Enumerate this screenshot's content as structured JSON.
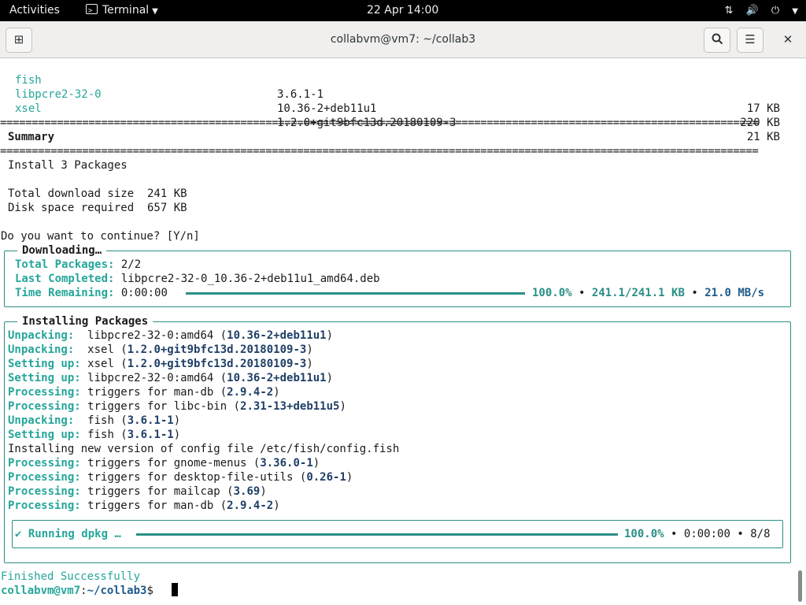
{
  "topbar": {
    "activities": "Activities",
    "app_name": "Terminal",
    "clock": "22 Apr  14:00"
  },
  "window": {
    "title": "collabvm@vm7: ~/collab3"
  },
  "packages": [
    {
      "name": "fish",
      "version": "3.6.1-1",
      "size": "17 KB"
    },
    {
      "name": "libpcre2-32-0",
      "version": "10.36-2+deb11u1",
      "size": "220 KB"
    },
    {
      "name": "xsel",
      "version": "1.2.0+git9bfc13d.20180109-3",
      "size": "21 KB"
    }
  ],
  "summary": {
    "heading": "Summary",
    "install_line": "Install 3 Packages",
    "download_line": "Total download size  241 KB",
    "disk_line": "Disk space required  657 KB",
    "prompt_question": "Do you want to continue? [Y/n]"
  },
  "downloading": {
    "title": "Downloading…",
    "total_label": "Total Packages:",
    "total_value": "2/2",
    "last_label": "Last Completed:",
    "last_value": "libpcre2-32-0_10.36-2+deb11u1_amd64.deb",
    "time_label": "Time Remaining:",
    "time_value": "0:00:00",
    "percent": "100.0%",
    "bullet": "•",
    "transferred": "241.1/241.1 KB",
    "speed": "21.0 MB/s",
    "progress": 1.0
  },
  "installing": {
    "title": "Installing Packages",
    "lines": [
      {
        "label": "Unpacking:  ",
        "text": "libpcre2-32-0:amd64 (",
        "ver": "10.36-2+deb11u1",
        "tail": ")"
      },
      {
        "label": "Unpacking:  ",
        "text": "xsel (",
        "ver": "1.2.0+git9bfc13d.20180109-3",
        "tail": ")"
      },
      {
        "label": "Setting up: ",
        "text": "xsel (",
        "ver": "1.2.0+git9bfc13d.20180109-3",
        "tail": ")"
      },
      {
        "label": "Setting up: ",
        "text": "libpcre2-32-0:amd64 (",
        "ver": "10.36-2+deb11u1",
        "tail": ")"
      },
      {
        "label": "Processing: ",
        "text": "triggers for man-db (",
        "ver": "2.9.4-2",
        "tail": ")"
      },
      {
        "label": "Processing: ",
        "text": "triggers for libc-bin (",
        "ver": "2.31-13+deb11u5",
        "tail": ")"
      },
      {
        "label": "Unpacking:  ",
        "text": "fish (",
        "ver": "3.6.1-1",
        "tail": ")"
      },
      {
        "label": "Setting up: ",
        "text": "fish (",
        "ver": "3.6.1-1",
        "tail": ")"
      },
      {
        "label": "",
        "text": "Installing new version of config file /etc/fish/config.fish",
        "ver": "",
        "tail": ""
      },
      {
        "label": "Processing: ",
        "text": "triggers for gnome-menus (",
        "ver": "3.36.0-1",
        "tail": ")"
      },
      {
        "label": "Processing: ",
        "text": "triggers for desktop-file-utils (",
        "ver": "0.26-1",
        "tail": ")"
      },
      {
        "label": "Processing: ",
        "text": "triggers for mailcap (",
        "ver": "3.69",
        "tail": ")"
      },
      {
        "label": "Processing: ",
        "text": "triggers for man-db (",
        "ver": "2.9.4-2",
        "tail": ")"
      }
    ],
    "dpkg": {
      "label": "✔ Running dpkg …",
      "percent": "100.0%",
      "bullet": "•",
      "time": "0:00:00",
      "count": "8/8",
      "progress": 1.0
    }
  },
  "finished": "Finished Successfully",
  "prompt": {
    "user_host": "collabvm@vm7",
    "sep": ":",
    "path": "~/collab3",
    "symbol": "$ "
  },
  "colors": {
    "accent_teal": "#26a69a",
    "version_navy": "#1f3f66",
    "panel_border": "#2a8f86"
  }
}
